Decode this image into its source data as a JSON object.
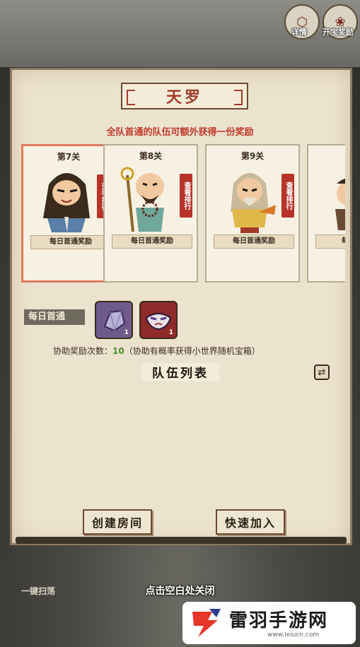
{
  "top_buttons": {
    "details_label": "详情",
    "rewards_label": "开宝奖励"
  },
  "panel": {
    "title": "天罗",
    "subtitle": "全队首通的队伍可额外获得一份奖励",
    "stages": [
      {
        "label": "第7关",
        "rank_tag": "查看排行",
        "reward_tag": "每日首通奖励",
        "selected": true
      },
      {
        "label": "第8关",
        "rank_tag": "查看排行",
        "reward_tag": "每日首通奖励",
        "selected": false
      },
      {
        "label": "第9关",
        "rank_tag": "查看排行",
        "reward_tag": "每日首通奖励",
        "selected": false
      },
      {
        "label": "",
        "rank_tag": "",
        "reward_tag": "每日首通",
        "selected": false
      }
    ],
    "daily_first_clear": {
      "label": "每日首通",
      "items": [
        {
          "icon": "crystal-icon",
          "count": "1",
          "color": "#6f5a8e"
        },
        {
          "icon": "mask-icon",
          "count": "1",
          "color": "#8e2a2a"
        }
      ]
    },
    "assist": {
      "prefix": "协助奖励次数：",
      "count": "10",
      "note": "（协助有概率获得小世界随机宝箱）"
    },
    "team_list_title": "队伍列表",
    "create_room_label": "创建房间",
    "quick_join_label": "快速加入"
  },
  "close_hint": "点击空白处关闭",
  "sweep_label": "一键扫荡",
  "watermark": {
    "text": "雷羽手游网",
    "url": "www.leiucn.com"
  }
}
